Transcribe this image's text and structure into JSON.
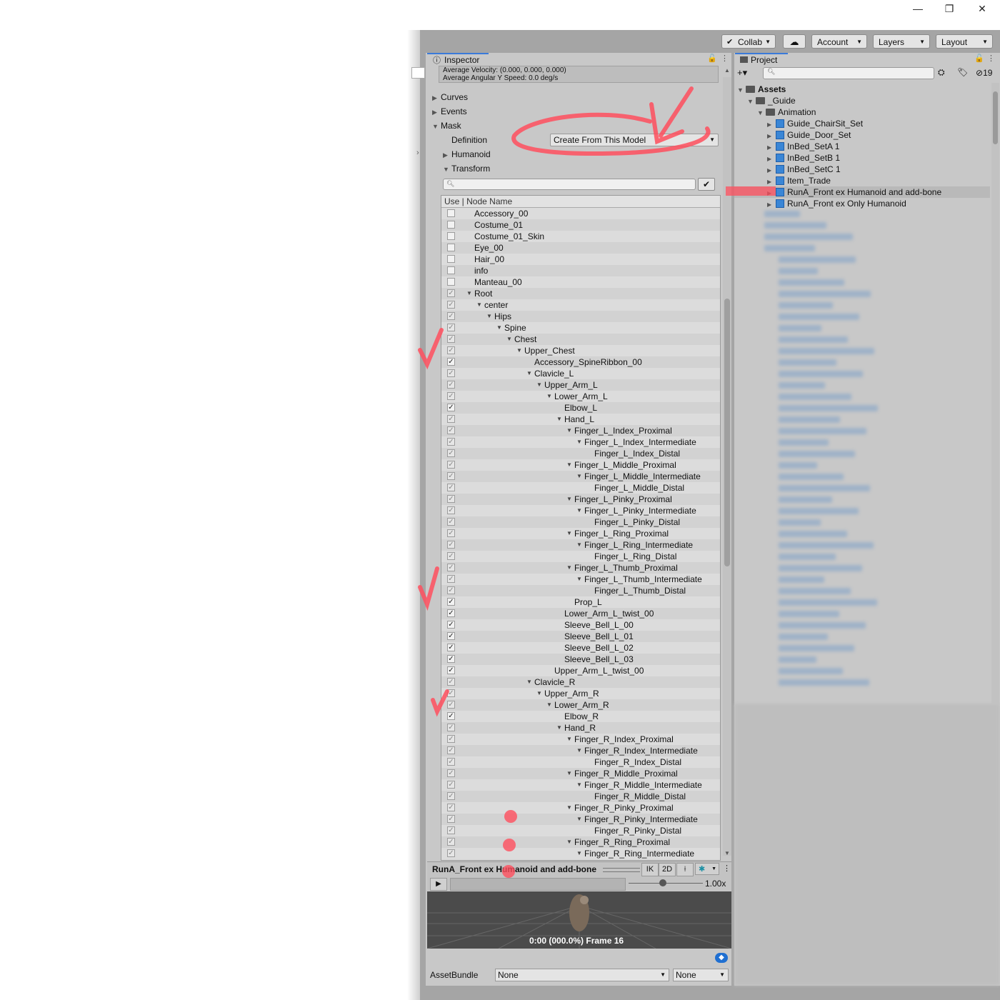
{
  "window": {
    "minimize": "—",
    "restore": "❐",
    "close": "✕"
  },
  "toolbar": {
    "collab": "Collab",
    "cloud": "☁",
    "account": "Account",
    "layers": "Layers",
    "layout": "Layout"
  },
  "inspector": {
    "tab_label": "Inspector",
    "average_velocity": "Average Velocity: (0.000, 0.000, 0.000)",
    "average_angular": "Average Angular Y Speed: 0.0 deg/s",
    "curves": "Curves",
    "events": "Events",
    "mask": "Mask",
    "definition_label": "Definition",
    "definition_value": "Create From This Model",
    "humanoid": "Humanoid",
    "transform": "Transform",
    "tree_header": "Use  |  Node Name",
    "nodes": [
      {
        "name": "Accessory_00",
        "depth": 0,
        "tri": false,
        "chk": "off"
      },
      {
        "name": "Costume_01",
        "depth": 0,
        "tri": false,
        "chk": "off"
      },
      {
        "name": "Costume_01_Skin",
        "depth": 0,
        "tri": false,
        "chk": "off"
      },
      {
        "name": "Eye_00",
        "depth": 0,
        "tri": false,
        "chk": "off"
      },
      {
        "name": "Hair_00",
        "depth": 0,
        "tri": false,
        "chk": "off"
      },
      {
        "name": "info",
        "depth": 0,
        "tri": false,
        "chk": "off"
      },
      {
        "name": "Manteau_00",
        "depth": 0,
        "tri": false,
        "chk": "off"
      },
      {
        "name": "Root",
        "depth": 0,
        "tri": true,
        "chk": "dim"
      },
      {
        "name": "center",
        "depth": 1,
        "tri": true,
        "chk": "dim"
      },
      {
        "name": "Hips",
        "depth": 2,
        "tri": true,
        "chk": "dim"
      },
      {
        "name": "Spine",
        "depth": 3,
        "tri": true,
        "chk": "dim"
      },
      {
        "name": "Chest",
        "depth": 4,
        "tri": true,
        "chk": "dim"
      },
      {
        "name": "Upper_Chest",
        "depth": 5,
        "tri": true,
        "chk": "dim"
      },
      {
        "name": "Accessory_SpineRibbon_00",
        "depth": 6,
        "tri": false,
        "chk": "on"
      },
      {
        "name": "Clavicle_L",
        "depth": 6,
        "tri": true,
        "chk": "dim"
      },
      {
        "name": "Upper_Arm_L",
        "depth": 7,
        "tri": true,
        "chk": "dim"
      },
      {
        "name": "Lower_Arm_L",
        "depth": 8,
        "tri": true,
        "chk": "dim"
      },
      {
        "name": "Elbow_L",
        "depth": 9,
        "tri": false,
        "chk": "on"
      },
      {
        "name": "Hand_L",
        "depth": 9,
        "tri": true,
        "chk": "dim"
      },
      {
        "name": "Finger_L_Index_Proximal",
        "depth": 10,
        "tri": true,
        "chk": "dim"
      },
      {
        "name": "Finger_L_Index_Intermediate",
        "depth": 11,
        "tri": true,
        "chk": "dim"
      },
      {
        "name": "Finger_L_Index_Distal",
        "depth": 12,
        "tri": false,
        "chk": "dim"
      },
      {
        "name": "Finger_L_Middle_Proximal",
        "depth": 10,
        "tri": true,
        "chk": "dim"
      },
      {
        "name": "Finger_L_Middle_Intermediate",
        "depth": 11,
        "tri": true,
        "chk": "dim"
      },
      {
        "name": "Finger_L_Middle_Distal",
        "depth": 12,
        "tri": false,
        "chk": "dim"
      },
      {
        "name": "Finger_L_Pinky_Proximal",
        "depth": 10,
        "tri": true,
        "chk": "dim"
      },
      {
        "name": "Finger_L_Pinky_Intermediate",
        "depth": 11,
        "tri": true,
        "chk": "dim"
      },
      {
        "name": "Finger_L_Pinky_Distal",
        "depth": 12,
        "tri": false,
        "chk": "dim"
      },
      {
        "name": "Finger_L_Ring_Proximal",
        "depth": 10,
        "tri": true,
        "chk": "dim"
      },
      {
        "name": "Finger_L_Ring_Intermediate",
        "depth": 11,
        "tri": true,
        "chk": "dim"
      },
      {
        "name": "Finger_L_Ring_Distal",
        "depth": 12,
        "tri": false,
        "chk": "dim"
      },
      {
        "name": "Finger_L_Thumb_Proximal",
        "depth": 10,
        "tri": true,
        "chk": "dim"
      },
      {
        "name": "Finger_L_Thumb_Intermediate",
        "depth": 11,
        "tri": true,
        "chk": "dim"
      },
      {
        "name": "Finger_L_Thumb_Distal",
        "depth": 12,
        "tri": false,
        "chk": "dim"
      },
      {
        "name": "Prop_L",
        "depth": 10,
        "tri": false,
        "chk": "on"
      },
      {
        "name": "Lower_Arm_L_twist_00",
        "depth": 9,
        "tri": false,
        "chk": "on"
      },
      {
        "name": "Sleeve_Bell_L_00",
        "depth": 9,
        "tri": false,
        "chk": "on"
      },
      {
        "name": "Sleeve_Bell_L_01",
        "depth": 9,
        "tri": false,
        "chk": "on"
      },
      {
        "name": "Sleeve_Bell_L_02",
        "depth": 9,
        "tri": false,
        "chk": "on"
      },
      {
        "name": "Sleeve_Bell_L_03",
        "depth": 9,
        "tri": false,
        "chk": "on"
      },
      {
        "name": "Upper_Arm_L_twist_00",
        "depth": 8,
        "tri": false,
        "chk": "on"
      },
      {
        "name": "Clavicle_R",
        "depth": 6,
        "tri": true,
        "chk": "dim"
      },
      {
        "name": "Upper_Arm_R",
        "depth": 7,
        "tri": true,
        "chk": "dim"
      },
      {
        "name": "Lower_Arm_R",
        "depth": 8,
        "tri": true,
        "chk": "dim"
      },
      {
        "name": "Elbow_R",
        "depth": 9,
        "tri": false,
        "chk": "on"
      },
      {
        "name": "Hand_R",
        "depth": 9,
        "tri": true,
        "chk": "dim"
      },
      {
        "name": "Finger_R_Index_Proximal",
        "depth": 10,
        "tri": true,
        "chk": "dim"
      },
      {
        "name": "Finger_R_Index_Intermediate",
        "depth": 11,
        "tri": true,
        "chk": "dim"
      },
      {
        "name": "Finger_R_Index_Distal",
        "depth": 12,
        "tri": false,
        "chk": "dim"
      },
      {
        "name": "Finger_R_Middle_Proximal",
        "depth": 10,
        "tri": true,
        "chk": "dim"
      },
      {
        "name": "Finger_R_Middle_Intermediate",
        "depth": 11,
        "tri": true,
        "chk": "dim"
      },
      {
        "name": "Finger_R_Middle_Distal",
        "depth": 12,
        "tri": false,
        "chk": "dim"
      },
      {
        "name": "Finger_R_Pinky_Proximal",
        "depth": 10,
        "tri": true,
        "chk": "dim"
      },
      {
        "name": "Finger_R_Pinky_Intermediate",
        "depth": 11,
        "tri": true,
        "chk": "dim"
      },
      {
        "name": "Finger_R_Pinky_Distal",
        "depth": 12,
        "tri": false,
        "chk": "dim"
      },
      {
        "name": "Finger_R_Ring_Proximal",
        "depth": 10,
        "tri": true,
        "chk": "dim"
      },
      {
        "name": "Finger_R_Ring_Intermediate",
        "depth": 11,
        "tri": true,
        "chk": "dim"
      }
    ],
    "preview_title": "RunA_Front ex Humanoid and add-bone",
    "ik": "IK",
    "twod": "2D",
    "speed": "1.00x",
    "frame_info": "0:00 (000.0%) Frame 16",
    "assetbundle_label": "AssetBundle",
    "assetbundle_value": "None",
    "variant_value": "None"
  },
  "project": {
    "tab_label": "Project",
    "add": "+▾",
    "hidden_count": "19",
    "assets": "Assets",
    "guide": "_Guide",
    "animation": "Animation",
    "items": [
      "Guide_ChairSit_Set",
      "Guide_Door_Set",
      "InBed_SetA 1",
      "InBed_SetB 1",
      "InBed_SetC 1",
      "Item_Trade",
      "RunA_Front ex Humanoid and add-bone",
      "RunA_Front ex Only Humanoid"
    ],
    "selected_index": 6
  },
  "colors": {
    "accent": "#3a7ad9",
    "annotation": "#ff4f5e",
    "selection": "#b9b9b9",
    "asset_icon": "#3a86d6"
  }
}
